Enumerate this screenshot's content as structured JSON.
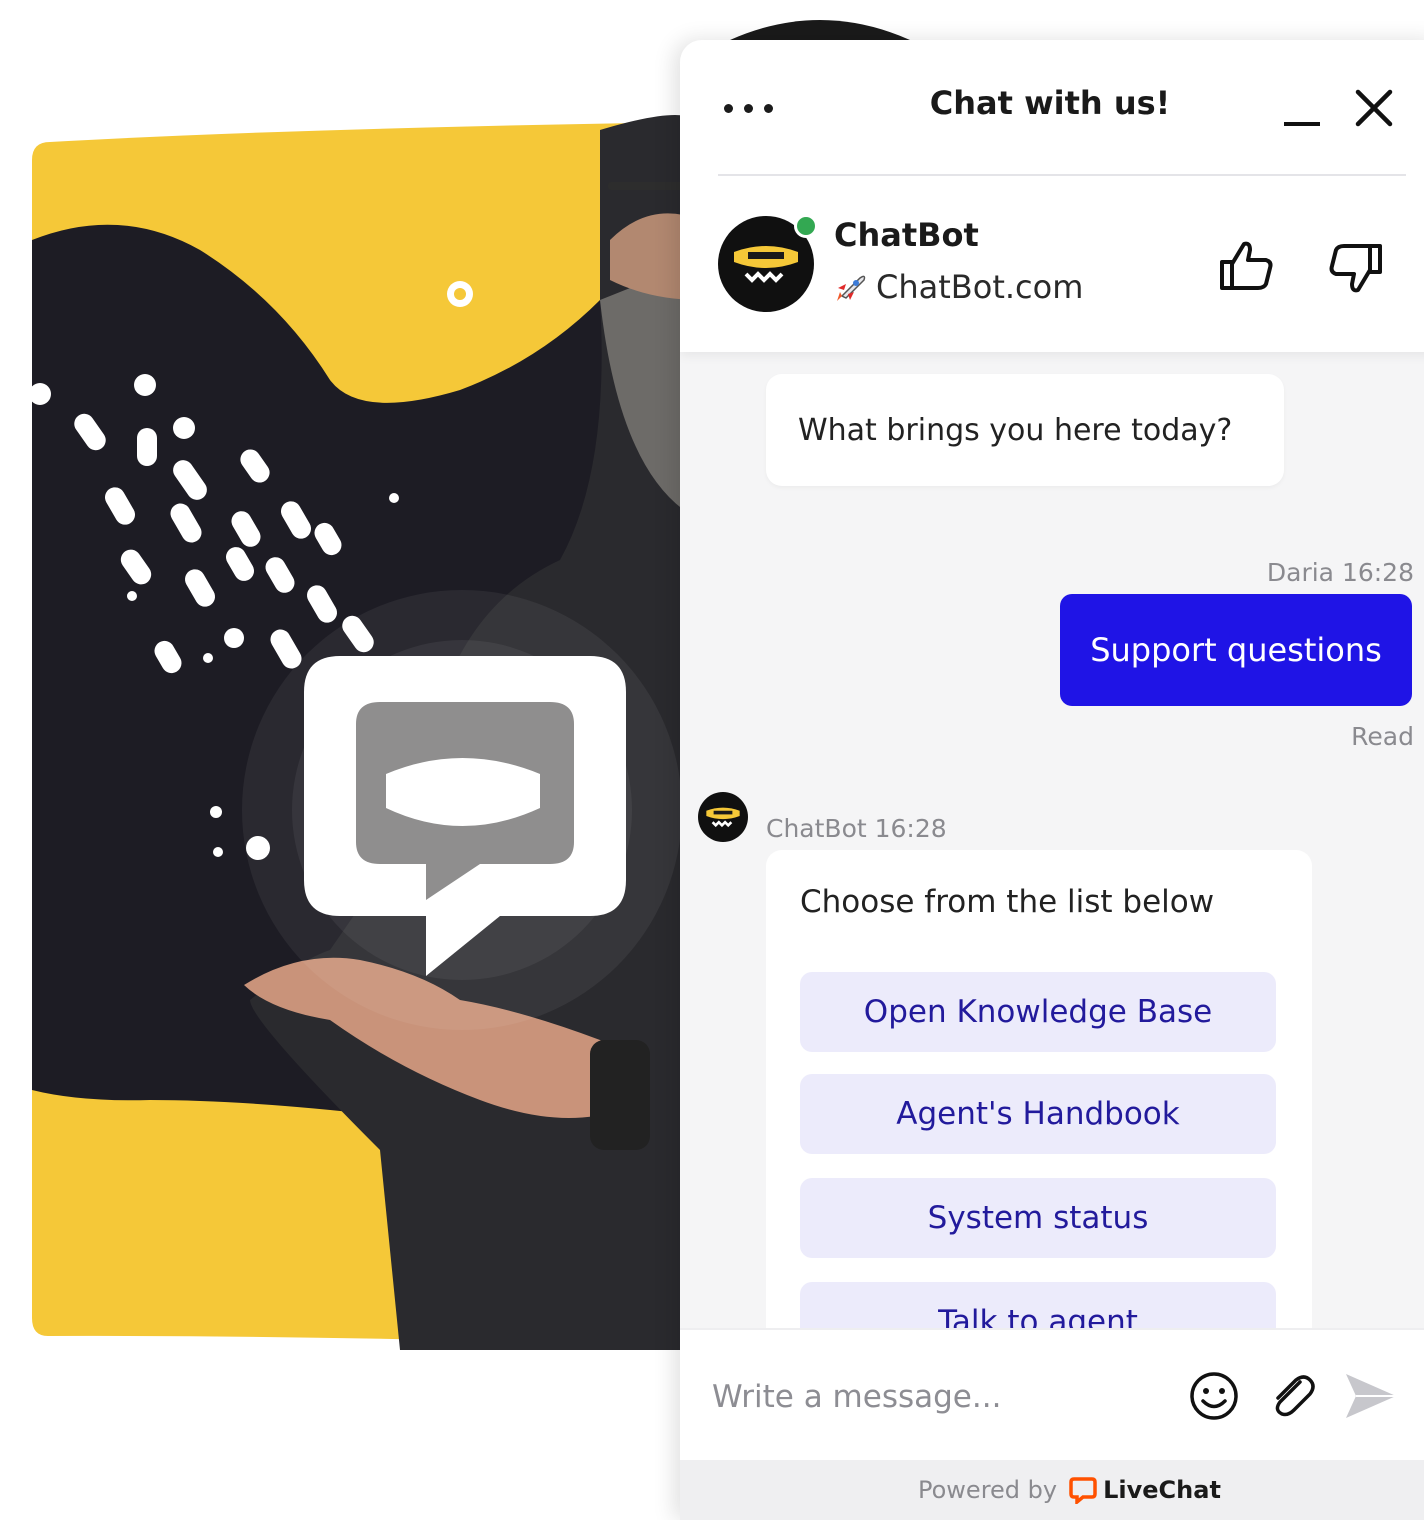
{
  "header": {
    "title": "Chat with us!"
  },
  "agent": {
    "name": "ChatBot",
    "site": "ChatBot.com"
  },
  "messages": {
    "bot_greeting": "What brings you here today?",
    "user_meta": "Daria 16:28",
    "user_message": "Support questions",
    "read_status": "Read",
    "bot_meta": "ChatBot 16:28",
    "bot_prompt": "Choose from the list below",
    "options": [
      "Open Knowledge Base",
      "Agent's Handbook",
      "System status",
      "Talk to agent"
    ]
  },
  "composer": {
    "placeholder": "Write a message..."
  },
  "footer": {
    "powered_by": "Powered by",
    "brand": "LiveChat"
  },
  "colors": {
    "accent": "#1f14e6",
    "background_yellow": "#f5c838",
    "background_dark": "#1d1c24",
    "online": "#33a852",
    "brand_orange": "#ff5100"
  },
  "icons": [
    "more-dots-icon",
    "minimize-icon",
    "close-icon",
    "thumbs-up-icon",
    "thumbs-down-icon",
    "rocket-icon",
    "emoji-icon",
    "paperclip-icon",
    "send-icon",
    "livechat-logo-icon",
    "chatbot-logo-icon"
  ]
}
